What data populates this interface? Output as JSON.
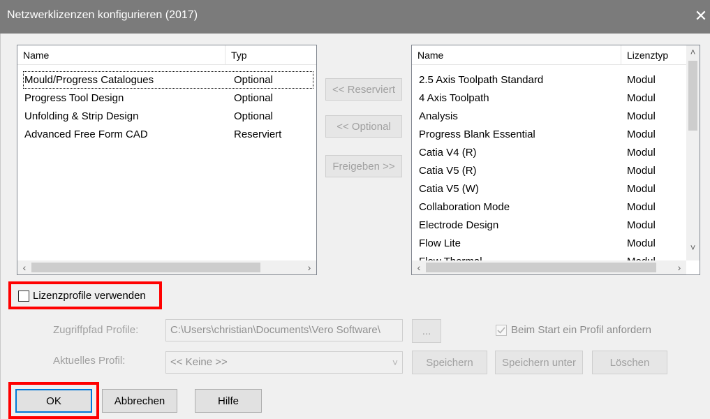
{
  "window": {
    "title": "Netzwerklizenzen konfigurieren (2017)",
    "close_glyph": "✕"
  },
  "left_list": {
    "columns": [
      "Name",
      "Typ"
    ],
    "rows": [
      {
        "name": "Mould/Progress Catalogues",
        "type": "Optional"
      },
      {
        "name": "Progress Tool Design",
        "type": "Optional"
      },
      {
        "name": "Unfolding & Strip Design",
        "type": "Optional"
      },
      {
        "name": "Advanced Free Form CAD",
        "type": "Reserviert"
      }
    ]
  },
  "middle_buttons": {
    "reserve": "<< Reserviert",
    "optional": "<< Optional",
    "release": "Freigeben >>"
  },
  "right_list": {
    "columns": [
      "Name",
      "Lizenztyp"
    ],
    "rows": [
      {
        "name": "2.5 Axis Toolpath Standard",
        "type": "Modul"
      },
      {
        "name": "4 Axis Toolpath",
        "type": "Modul"
      },
      {
        "name": "Analysis",
        "type": "Modul"
      },
      {
        "name": "Progress Blank Essential",
        "type": "Modul"
      },
      {
        "name": "Catia V4 (R)",
        "type": "Modul"
      },
      {
        "name": "Catia V5 (R)",
        "type": "Modul"
      },
      {
        "name": "Catia V5 (W)",
        "type": "Modul"
      },
      {
        "name": "Collaboration Mode",
        "type": "Modul"
      },
      {
        "name": "Electrode Design",
        "type": "Modul"
      },
      {
        "name": "Flow Lite",
        "type": "Modul"
      },
      {
        "name": "Flow Thermal",
        "type": "Modul"
      }
    ]
  },
  "scroll": {
    "left": "‹",
    "right": "›",
    "up": "˄",
    "down": "˅"
  },
  "profiles": {
    "checkbox_label": "Lizenzprofile verwenden",
    "path_label": "Zugriffpfad Profile:",
    "path_value": "C:\\Users\\christian\\Documents\\Vero Software\\",
    "browse_label": "...",
    "request_label": "Beim Start ein Profil anfordern",
    "current_label": "Aktuelles Profil:",
    "current_value": "<< Keine >>",
    "save": "Speichern",
    "save_as": "Speichern unter",
    "delete": "Löschen"
  },
  "footer": {
    "ok": "OK",
    "cancel": "Abbrechen",
    "help": "Hilfe"
  },
  "colors": {
    "titlebar": "#7b7b7b",
    "highlight": "#ff0000",
    "focus": "#0078d7"
  }
}
